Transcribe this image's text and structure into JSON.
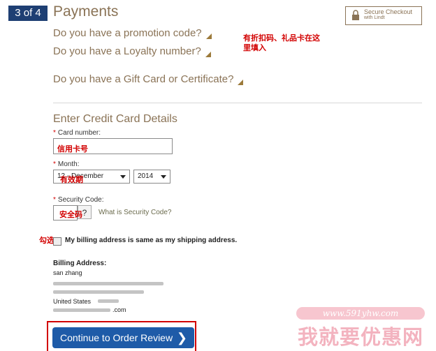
{
  "header": {
    "step": "3 of 4",
    "title": "Payments",
    "secure_line1": "Secure Checkout",
    "secure_line2": "with Lindt"
  },
  "questions": {
    "promo": "Do you have a promotion code?",
    "loyalty": "Do you have a Loyalty number?",
    "gift": "Do you have a Gift Card or Certificate?"
  },
  "annotations": {
    "promo_note_line1": "有折扣码、礼品卡在这",
    "promo_note_line2": "里填入",
    "card_note": "信用卡号",
    "month_note": "有效期",
    "security_note": "安全码",
    "check_note": "勾选"
  },
  "credit_card": {
    "section_title": "Enter Credit Card Details",
    "required_mark": "*",
    "card_number_label": "Card number:",
    "month_label": "Month:",
    "month_value": "12 - December",
    "year_value": "2014",
    "security_label": "Security Code:",
    "help_button": "?",
    "security_link": "What is Security Code?"
  },
  "billing": {
    "same_as_shipping_label": "My billing address is same as my shipping address.",
    "heading": "Billing Address:",
    "name": "san zhang",
    "country_line": "United States",
    "email_suffix": ".com"
  },
  "cta": {
    "label": "Continue to Order Review",
    "chevron": "❯"
  },
  "watermark": {
    "url": "www.591yhw.com",
    "text": "我就要优惠网"
  },
  "colors": {
    "brand_blue": "#1e3f73",
    "button_blue": "#1e5ba8",
    "gold": "#8a7356",
    "annotation_red": "#d20000"
  }
}
